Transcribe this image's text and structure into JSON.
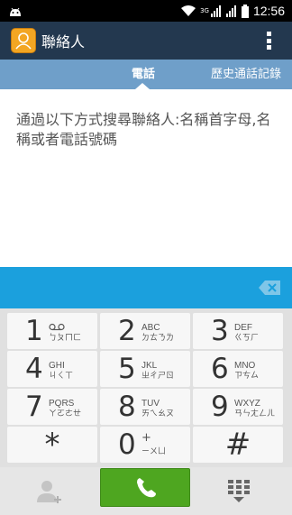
{
  "status_bar": {
    "time": "12:56",
    "network": "3G",
    "icons": [
      "android-icon",
      "wifi-icon",
      "signal-3g-icon",
      "signal-icon",
      "battery-icon"
    ]
  },
  "app": {
    "title": "聯絡人",
    "icon": "contacts-icon",
    "menu_icon": "overflow-menu-icon"
  },
  "tabs": [
    {
      "label": "電話",
      "selected": true
    },
    {
      "label": "歷史通話記錄",
      "selected": false
    }
  ],
  "hint": "通過以下方式搜尋聯絡人:名稱首字母,名稱或者電話號碼",
  "input": {
    "value": "",
    "backspace_icon": "backspace-icon"
  },
  "keys": [
    {
      "digit": "1",
      "letters": "",
      "bopomofo": "ㄅㄆㄇㄈ"
    },
    {
      "digit": "2",
      "letters": "ABC",
      "bopomofo": "ㄉㄊㄋㄌ"
    },
    {
      "digit": "3",
      "letters": "DEF",
      "bopomofo": "ㄍㄎㄏ"
    },
    {
      "digit": "4",
      "letters": "GHI",
      "bopomofo": "ㄐㄑㄒ"
    },
    {
      "digit": "5",
      "letters": "JKL",
      "bopomofo": "ㄓㄔㄕㄖ"
    },
    {
      "digit": "6",
      "letters": "MNO",
      "bopomofo": "ㄗㄘㄙ"
    },
    {
      "digit": "7",
      "letters": "PQRS",
      "bopomofo": "ㄚㄛㄜㄝ"
    },
    {
      "digit": "8",
      "letters": "TUV",
      "bopomofo": "ㄞㄟㄠㄡ"
    },
    {
      "digit": "9",
      "letters": "WXYZ",
      "bopomofo": "ㄢㄣㄤㄥㄦ"
    },
    {
      "digit": "*",
      "letters": "",
      "bopomofo": ""
    },
    {
      "digit": "0",
      "letters": "+",
      "bopomofo": "ㄧㄨㄩ"
    },
    {
      "digit": "#",
      "letters": "",
      "bopomofo": ""
    }
  ],
  "bottom_bar": {
    "add_contact_icon": "add-contact-icon",
    "call_icon": "phone-icon",
    "dialpad_icon": "dialpad-toggle-icon",
    "call_color": "#4ea620"
  },
  "colors": {
    "header": "#23384f",
    "tabs": "#6f9fc9",
    "input_bar": "#1ba0dd"
  }
}
